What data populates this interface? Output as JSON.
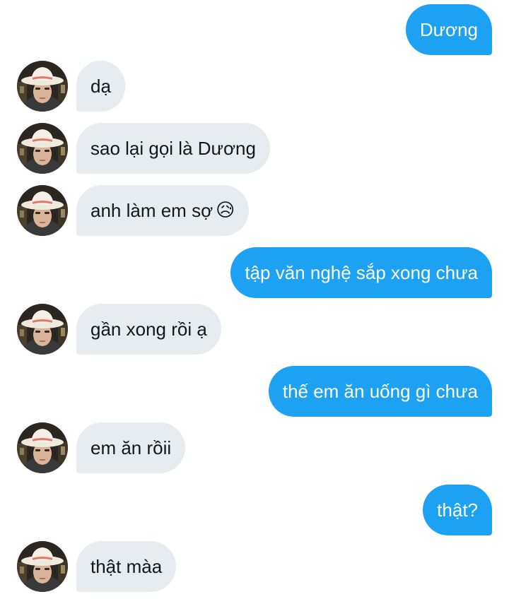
{
  "messages": [
    {
      "direction": "sent",
      "text": "Dương"
    },
    {
      "direction": "received",
      "text": "dạ"
    },
    {
      "direction": "received",
      "text": "sao lại gọi là Dương"
    },
    {
      "direction": "received",
      "text": "anh làm em sợ",
      "emoji": "😥"
    },
    {
      "direction": "sent",
      "text": "tập văn nghệ sắp xong chưa"
    },
    {
      "direction": "received",
      "text": "gần xong rồi ạ"
    },
    {
      "direction": "sent",
      "text": "thế em ăn uống gì chưa"
    },
    {
      "direction": "received",
      "text": "em ăn rồii"
    },
    {
      "direction": "sent",
      "text": "thật?"
    },
    {
      "direction": "received",
      "text": "thật màa"
    }
  ],
  "colors": {
    "sent_bubble": "#1da1f2",
    "received_bubble": "#e6ecf0",
    "sent_text": "#ffffff",
    "received_text": "#14171a"
  },
  "icons": {
    "avatar": "profile-photo"
  }
}
